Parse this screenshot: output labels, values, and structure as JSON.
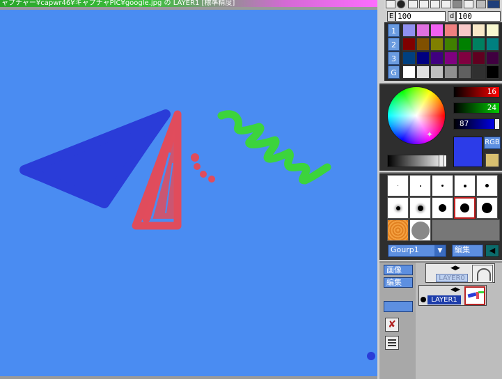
{
  "window": {
    "title": "ャプチャー¥capwr46¥キャプチャPIC¥google.jpg の LAYER1 [標準精度]"
  },
  "fields": {
    "opacity_label": "E",
    "opacity_value": "100",
    "density_label": "d",
    "density_value": "100"
  },
  "palette": {
    "row_tabs": [
      "1",
      "2",
      "3",
      "G"
    ],
    "rows": [
      [
        "#9090f0",
        "#e070e0",
        "#f060f0",
        "#f08080",
        "#f8c8c8",
        "#f8e8c8",
        "#f8f8d0"
      ],
      [
        "#800000",
        "#805000",
        "#808000",
        "#408000",
        "#008000",
        "#008060",
        "#008080"
      ],
      [
        "#004080",
        "#000080",
        "#400080",
        "#800080",
        "#800040",
        "#600020",
        "#400040"
      ],
      [
        "#ffffff",
        "#e0e0e0",
        "#c0c0c0",
        "#909090",
        "#606060",
        "#303030",
        "#000000"
      ]
    ]
  },
  "color": {
    "red": "16",
    "green": "24",
    "blue": "87",
    "current_hex": "#2c3ce8",
    "mode_button": "RGB"
  },
  "brushes": {
    "group_name": "Gourp1",
    "edit_label": "編集",
    "selected_index": 8
  },
  "layers": {
    "image_button": "画像",
    "edit_button": "編集",
    "items": [
      {
        "name": "LAYER0"
      },
      {
        "name": "LAYER1"
      }
    ]
  },
  "canvas": {
    "background": "#4a8cf2",
    "stroke_colors": [
      "#2a3cd8",
      "#e04c5c",
      "#3cd43c"
    ]
  }
}
